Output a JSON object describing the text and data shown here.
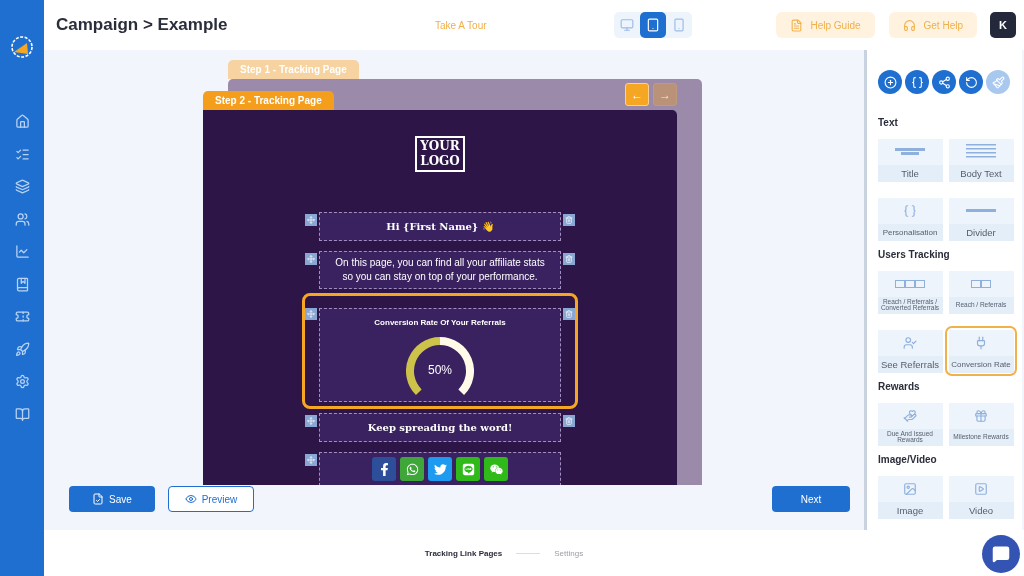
{
  "header": {
    "breadcrumb": "Campaign > Example",
    "tour_link": "Take A Tour",
    "devices": [
      {
        "kind": "desktop",
        "selected": false
      },
      {
        "kind": "tablet",
        "selected": true
      },
      {
        "kind": "mobile",
        "selected": false
      }
    ],
    "help_guide": "Help Guide",
    "get_help": "Get Help",
    "avatar": "K"
  },
  "editor": {
    "steps": [
      {
        "label": "Step 1 - Tracking Page",
        "selected": false
      },
      {
        "label": "Step 2 - Tracking Page",
        "selected": true
      }
    ],
    "nav": [
      {
        "symbol": "←",
        "disabled": false
      },
      {
        "symbol": "→",
        "disabled": true
      }
    ],
    "logo": [
      "YOUR",
      "LOGO"
    ],
    "blocks": [
      {
        "kind": "title",
        "text": "Hi {First Name} 👋",
        "highlighted": false,
        "deletable": true
      },
      {
        "kind": "paragraph",
        "text": "On this page, you can find all your affiliate stats so you can stay on top of your performance.",
        "highlighted": false,
        "deletable": true
      },
      {
        "kind": "gauge",
        "title": "Conversion Rate Of Your Referrals",
        "level": 0.5,
        "reading": "50%",
        "highlighted": true,
        "deletable": true
      },
      {
        "kind": "title",
        "text": "Keep spreading the word!",
        "highlighted": false,
        "deletable": true
      },
      {
        "kind": "social",
        "highlighted": false,
        "deletable": false
      }
    ]
  },
  "actions": {
    "save": "Save",
    "preview": "Preview",
    "next": "Next"
  },
  "panel": {
    "tools": [
      {
        "kind": "add",
        "disabled": false
      },
      {
        "kind": "braces",
        "disabled": false
      },
      {
        "kind": "share",
        "disabled": false
      },
      {
        "kind": "undo",
        "disabled": false
      },
      {
        "kind": "clear",
        "disabled": true
      }
    ],
    "sections": [
      {
        "title": "Text",
        "tiles": [
          {
            "kind": "title",
            "label": "Title",
            "selected": false
          },
          {
            "kind": "body",
            "label": "Body Text",
            "selected": false
          },
          {
            "kind": "braces",
            "label": "Personalisation",
            "selected": false
          },
          {
            "kind": "divider",
            "label": "Divider",
            "selected": false
          }
        ]
      },
      {
        "title": "Users Tracking",
        "tiles": [
          {
            "kind": "stats3",
            "label": "Reach / Referrals / Converted Referrals",
            "selected": false
          },
          {
            "kind": "stats2",
            "label": "Reach / Referrals",
            "selected": false
          },
          {
            "kind": "referrals",
            "label": "See Referrals",
            "selected": false
          },
          {
            "kind": "conversion",
            "label": "Conversion Rate",
            "selected": true
          }
        ]
      },
      {
        "title": "Rewards",
        "tiles": [
          {
            "kind": "rewards",
            "label": "Due And Issued Rewards",
            "selected": false
          },
          {
            "kind": "milestones",
            "label": "Milestone Rewards",
            "selected": false
          }
        ]
      },
      {
        "title": "Image/Video",
        "tiles": [
          {
            "kind": "image",
            "label": "Image",
            "selected": false
          },
          {
            "kind": "video",
            "label": "Video",
            "selected": false
          }
        ]
      }
    ]
  },
  "footer": {
    "steps": [
      {
        "label": "Tracking Link Pages",
        "selected": true
      },
      {
        "label": "Settings",
        "selected": false
      }
    ]
  }
}
